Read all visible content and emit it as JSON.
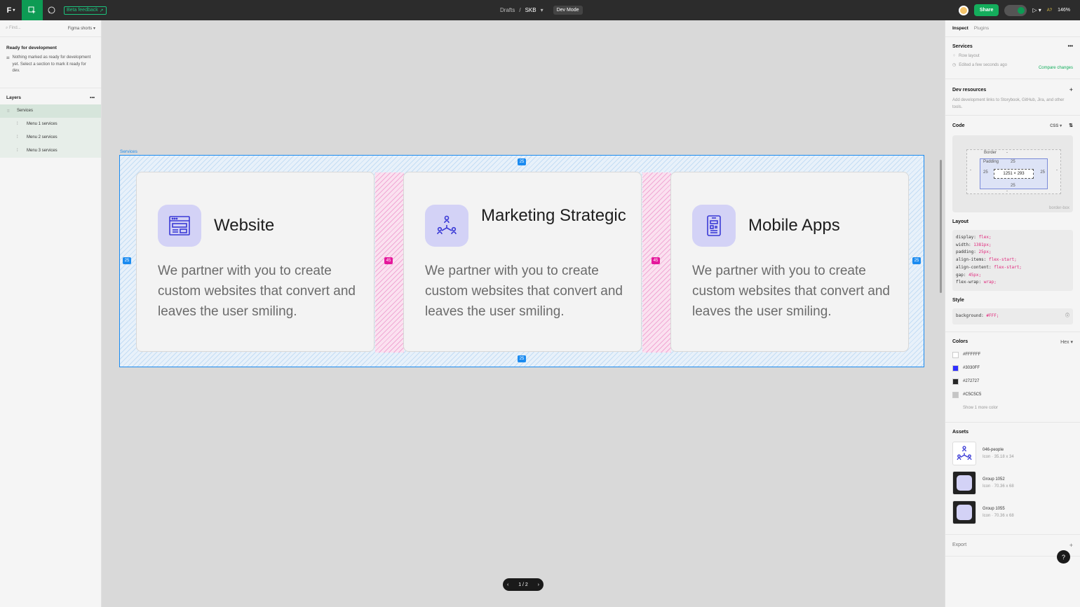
{
  "topbar": {
    "logo": "F",
    "beta_feedback": "Beta feedback",
    "breadcrumb_drafts": "Drafts",
    "breadcrumb_sep": "/",
    "file_name": "SKB",
    "dev_mode": "Dev Mode",
    "share": "Share",
    "aa": "A?",
    "zoom": "146%"
  },
  "left": {
    "search_placeholder": "Find...",
    "shortcut_label": "Figma shorts",
    "ready_title": "Ready for development",
    "ready_note": "Nothing marked as ready for development yet. Select a section to mark it ready for dev.",
    "layers_title": "Layers",
    "layers": [
      {
        "label": "Services"
      },
      {
        "label": "Menu 1 services"
      },
      {
        "label": "Menu 2 services"
      },
      {
        "label": "Menu 3 services"
      }
    ]
  },
  "canvas": {
    "frame_label": "Services",
    "padding_badge": "25",
    "gap_badge": "45",
    "cards": [
      {
        "title": "Website",
        "desc": "We partner with you to create custom websites that convert and leaves the user smiling.",
        "icon": "website-icon"
      },
      {
        "title": "Marketing Strategic",
        "desc": "We partner with you to create custom websites that convert and leaves the user smiling.",
        "icon": "people-icon"
      },
      {
        "title": "Mobile Apps",
        "desc": "We partner with you to create custom websites that convert and leaves the user smiling.",
        "icon": "mobile-icon"
      }
    ],
    "pager": "1 / 2"
  },
  "right": {
    "tab_inspect": "Inspect",
    "tab_plugins": "Plugins",
    "selection_title": "Services",
    "row_layout": "Row layout",
    "edited": "Edited a few seconds ago",
    "compare": "Compare changes",
    "dev_resources_title": "Dev resources",
    "dev_resources_desc": "Add development links to Storybook, GitHub, Jira, and other tools.",
    "code_title": "Code",
    "code_lang": "CSS",
    "box": {
      "border": "Border",
      "padding": "Padding",
      "pad": "25",
      "size": "1251 × 293",
      "dash": "-",
      "box_sizing": "border-box"
    },
    "layout_title": "Layout",
    "layout_code": [
      {
        "prop": "display: ",
        "val": "flex;"
      },
      {
        "prop": "width: ",
        "val": "1381px;"
      },
      {
        "prop": "padding: ",
        "val": "25px;"
      },
      {
        "prop": "align-items: ",
        "val": "flex-start;"
      },
      {
        "prop": "align-content: ",
        "val": "flex-start;"
      },
      {
        "prop": "gap: ",
        "val": "45px;"
      },
      {
        "prop": "flex-wrap: ",
        "val": "wrap;"
      }
    ],
    "style_title": "Style",
    "style_prop": "background: ",
    "style_val": "#FFF;",
    "colors_title": "Colors",
    "colors_format": "Hex",
    "colors": [
      {
        "hex": "#FFFFFF"
      },
      {
        "hex": "#3030FF"
      },
      {
        "hex": "#272727"
      },
      {
        "hex": "#C5C5C5"
      }
    ],
    "more_colors": "Show 1 more color",
    "assets_title": "Assets",
    "assets": [
      {
        "name": "046-people",
        "meta": "Icon · 35.18 x 34"
      },
      {
        "name": "Group 1052",
        "meta": "Icon · 70.36 x 68"
      },
      {
        "name": "Group 1055",
        "meta": "Icon · 70.36 x 68"
      }
    ],
    "export_title": "Export",
    "help": "?"
  }
}
